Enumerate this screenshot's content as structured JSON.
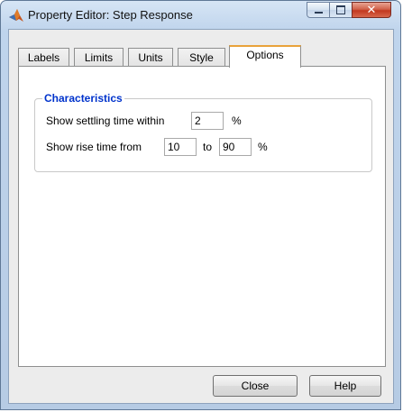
{
  "window": {
    "title": "Property Editor: Step Response"
  },
  "tabs": [
    {
      "label": "Labels"
    },
    {
      "label": "Limits"
    },
    {
      "label": "Units"
    },
    {
      "label": "Style"
    },
    {
      "label": "Options",
      "active": true
    }
  ],
  "characteristics": {
    "title": "Characteristics",
    "settling_label": "Show settling time within",
    "settling_value": "2",
    "settling_unit": "%",
    "rise_label": "Show rise time from",
    "rise_from": "10",
    "rise_to_label": "to",
    "rise_to": "90",
    "rise_unit": "%"
  },
  "buttons": {
    "close": "Close",
    "help": "Help"
  },
  "colors": {
    "group_title": "#0033cc",
    "active_tab_accent": "#e9a23b",
    "close_caption": "#c2381f"
  },
  "icons": {
    "app": "matlab-logo-icon",
    "minimize": "minimize-icon",
    "maximize": "maximize-icon",
    "close": "close-icon"
  }
}
